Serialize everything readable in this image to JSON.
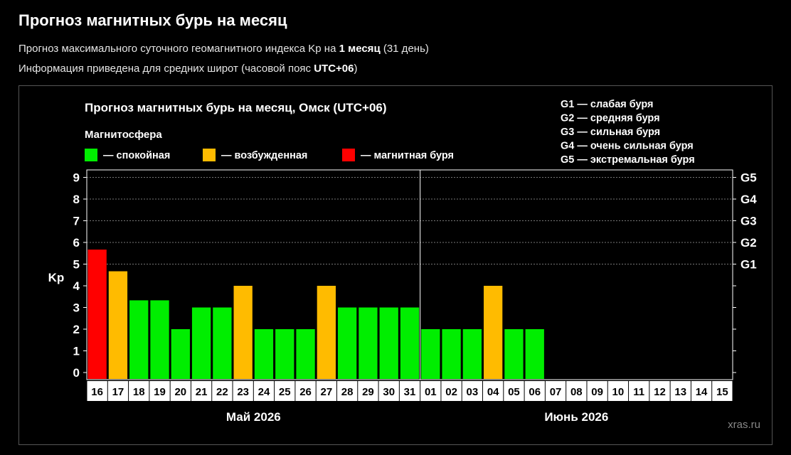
{
  "header": {
    "title": "Прогноз магнитных бурь на месяц",
    "line1": {
      "before": "Прогноз максимального суточного геомагнитного индекса Kp на ",
      "bold": "1 месяц",
      "after": " (31 день)"
    },
    "line2": {
      "before": "Информация приведена для средних широт (часовой пояс ",
      "bold": "UTC+06",
      "after": ")"
    }
  },
  "colors": {
    "calm": "#00ee00",
    "excited": "#ffbb00",
    "storm": "#ff0000",
    "background": "#000000"
  },
  "chart_data": {
    "type": "bar",
    "title": "Прогноз магнитных бурь на месяц, Омск (UTC+06)",
    "legend_title": "Магнитосфера",
    "legend": [
      {
        "status": "calm",
        "label": "— спокойная"
      },
      {
        "status": "excited",
        "label": "— возбужденная"
      },
      {
        "status": "storm",
        "label": "— магнитная буря"
      }
    ],
    "storm_levels": [
      {
        "code": "G1",
        "text": " — слабая буря",
        "kp": 5
      },
      {
        "code": "G2",
        "text": " — средняя буря",
        "kp": 6
      },
      {
        "code": "G3",
        "text": " — сильная буря",
        "kp": 7
      },
      {
        "code": "G4",
        "text": " — очень сильная буря",
        "kp": 8
      },
      {
        "code": "G5",
        "text": " — экстремальная буря",
        "kp": 9
      }
    ],
    "ylabel": "Kp",
    "ylim": [
      0,
      9
    ],
    "yticks": [
      0,
      1,
      2,
      3,
      4,
      5,
      6,
      7,
      8,
      9
    ],
    "grid": true,
    "categories": [
      "16",
      "17",
      "18",
      "19",
      "20",
      "21",
      "22",
      "23",
      "24",
      "25",
      "26",
      "27",
      "28",
      "29",
      "30",
      "31",
      "01",
      "02",
      "03",
      "04",
      "05",
      "06",
      "07",
      "08",
      "09",
      "10",
      "11",
      "12",
      "13",
      "14",
      "15"
    ],
    "values": [
      5.67,
      4.67,
      3.33,
      3.33,
      2,
      3,
      3,
      4,
      2,
      2,
      2,
      4,
      3,
      3,
      3,
      3,
      2,
      2,
      2,
      4,
      2,
      2,
      null,
      null,
      null,
      null,
      null,
      null,
      null,
      null,
      null
    ],
    "status": [
      "storm",
      "excited",
      "calm",
      "calm",
      "calm",
      "calm",
      "calm",
      "excited",
      "calm",
      "calm",
      "calm",
      "excited",
      "calm",
      "calm",
      "calm",
      "calm",
      "calm",
      "calm",
      "calm",
      "excited",
      "calm",
      "calm",
      null,
      null,
      null,
      null,
      null,
      null,
      null,
      null,
      null
    ],
    "months": [
      {
        "label": "Май 2026",
        "days": 16
      },
      {
        "label": "Июнь 2026",
        "days": 15
      }
    ],
    "watermark": "xras.ru"
  }
}
